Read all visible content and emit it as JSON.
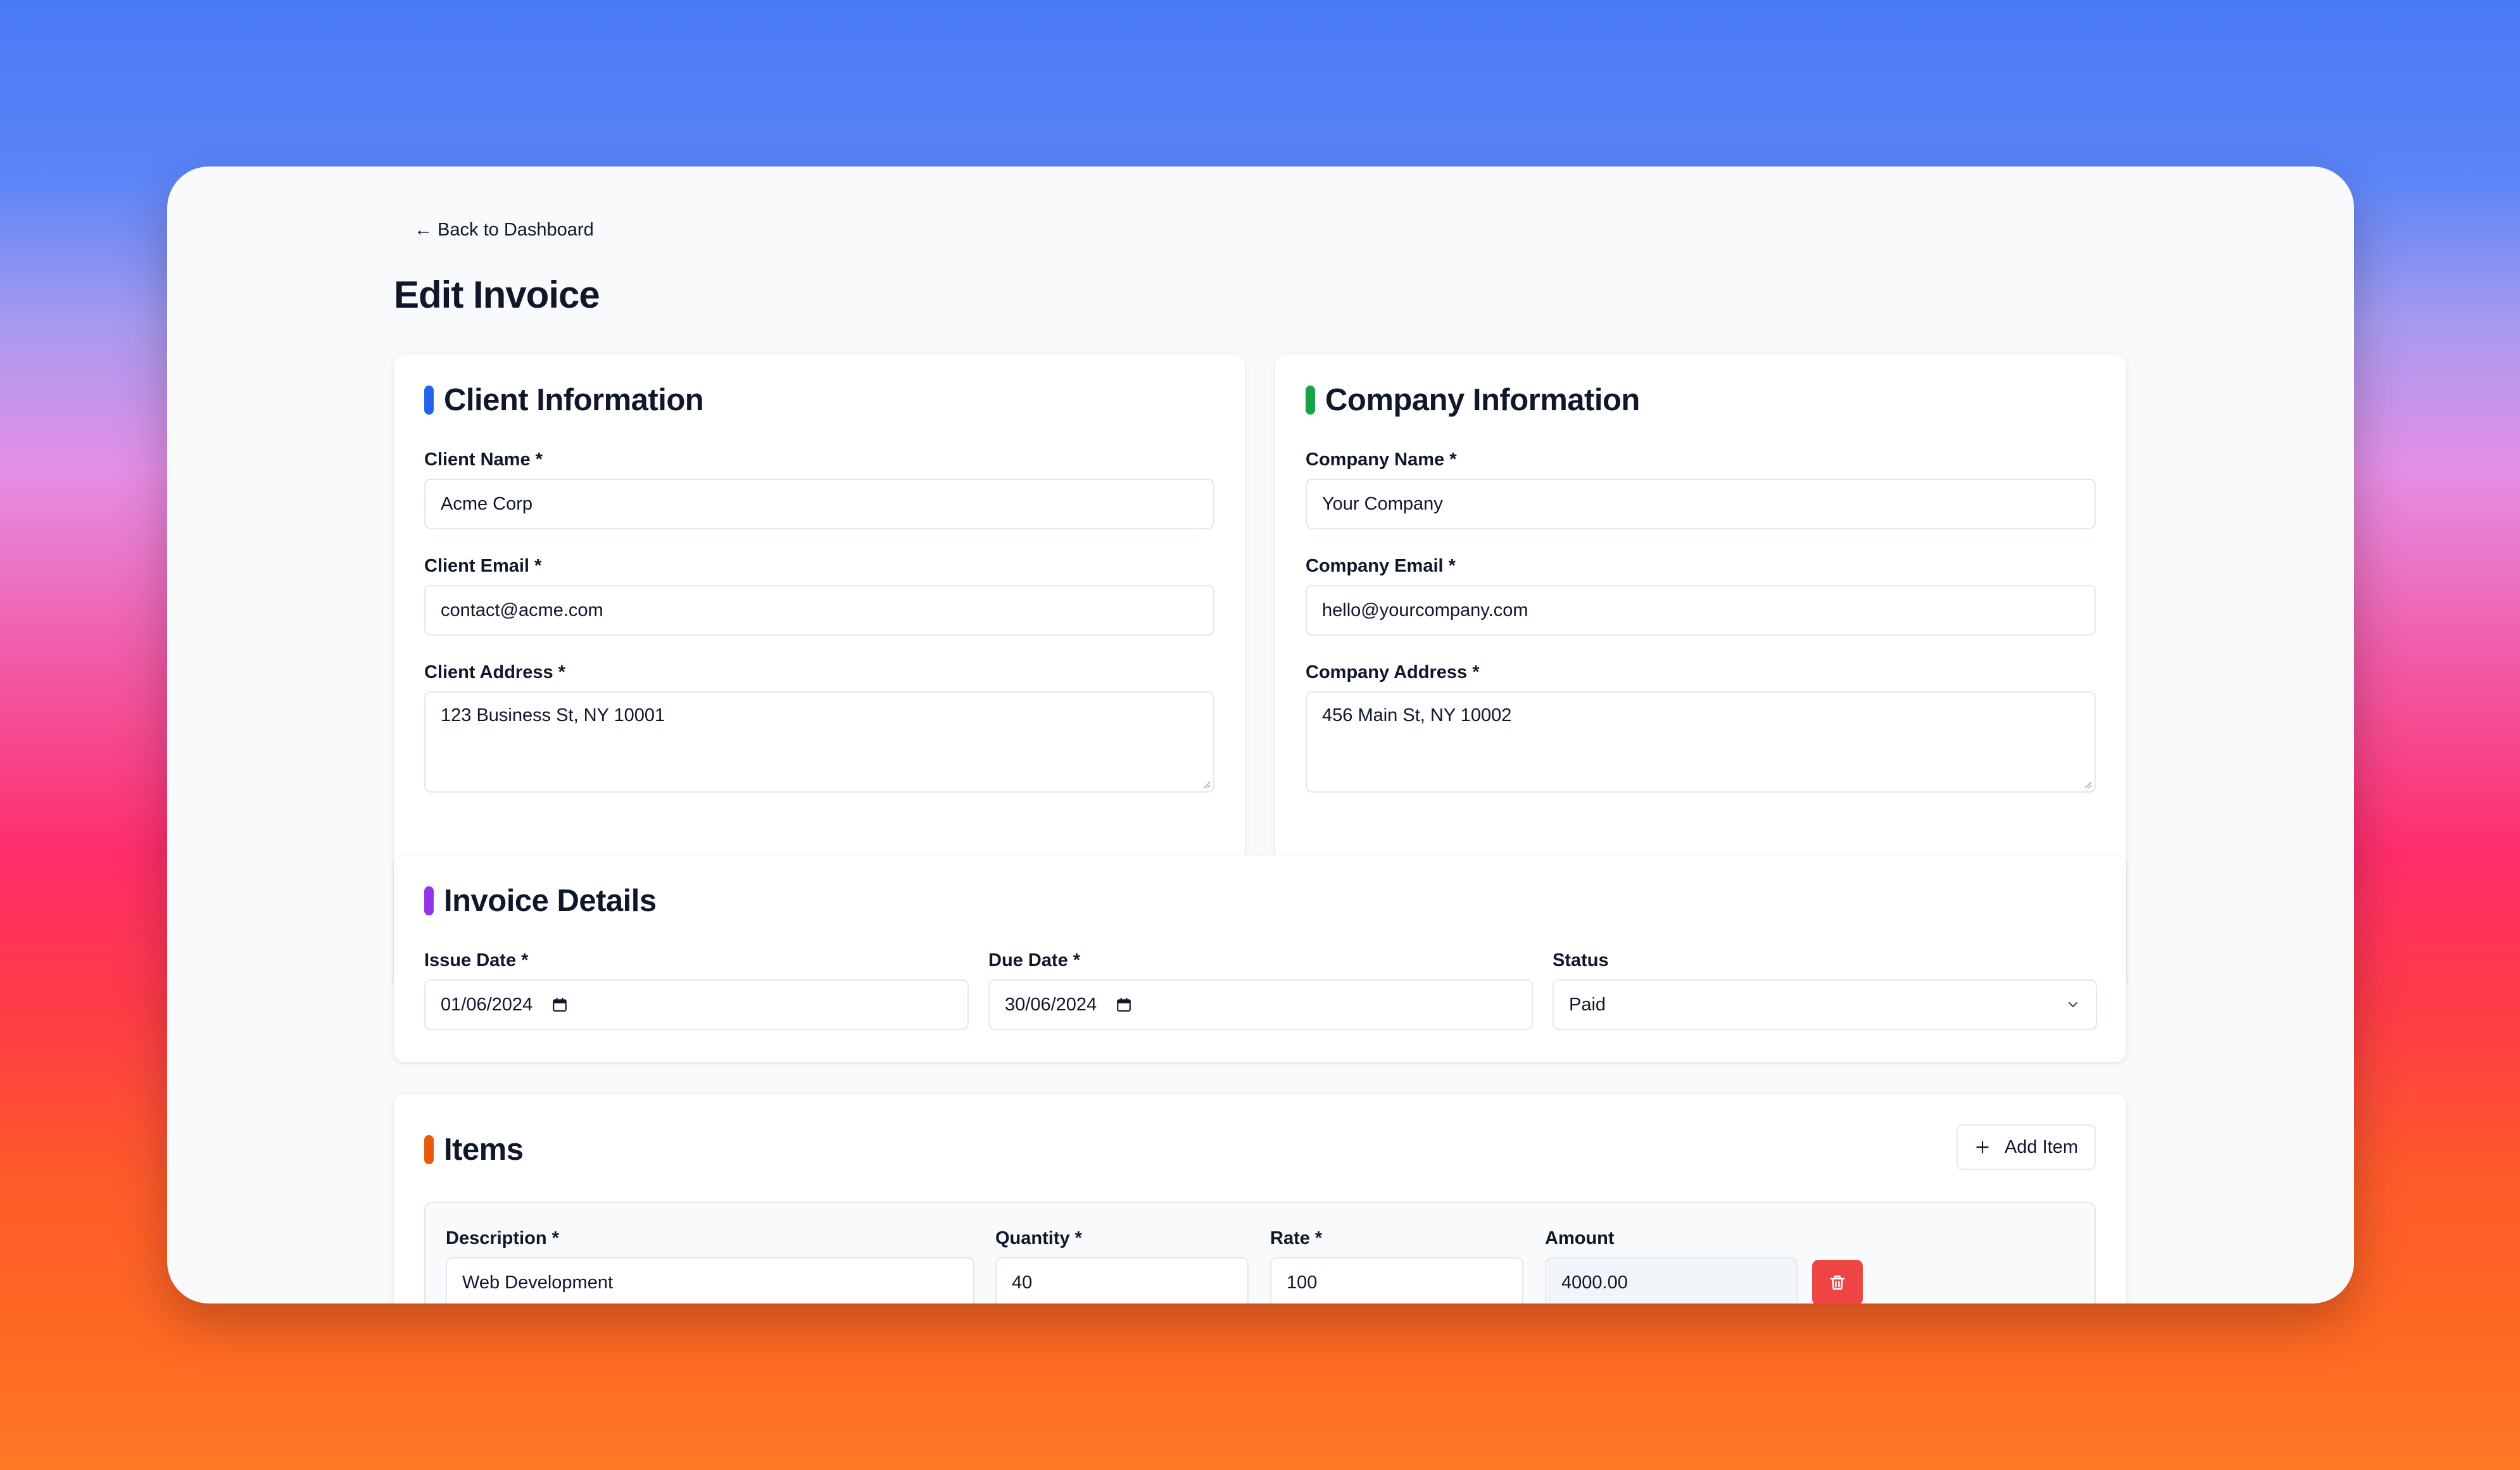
{
  "nav": {
    "back_label": "← Back to Dashboard"
  },
  "page": {
    "title": "Edit Invoice"
  },
  "client": {
    "title": "Client Information",
    "accent": "#2563eb",
    "name_label": "Client Name *",
    "name_value": "Acme Corp",
    "email_label": "Client Email *",
    "email_value": "contact@acme.com",
    "address_label": "Client Address *",
    "address_value": "123 Business St, NY 10001"
  },
  "company": {
    "title": "Company Information",
    "accent": "#16a34a",
    "name_label": "Company Name *",
    "name_value": "Your Company",
    "email_label": "Company Email *",
    "email_value": "hello@yourcompany.com",
    "address_label": "Company Address *",
    "address_value": "456 Main St, NY 10002"
  },
  "details": {
    "title": "Invoice Details",
    "accent": "#9333ea",
    "issue_label": "Issue Date *",
    "issue_value": "01/06/2024",
    "due_label": "Due Date *",
    "due_value": "30/06/2024",
    "status_label": "Status",
    "status_value": "Paid"
  },
  "items": {
    "title": "Items",
    "accent": "#ea580c",
    "add_label": "Add Item",
    "columns": {
      "description": "Description *",
      "quantity": "Quantity *",
      "rate": "Rate *",
      "amount": "Amount"
    },
    "rows": [
      {
        "description": "Web Development",
        "quantity": "40",
        "rate": "100",
        "amount": "4000.00"
      }
    ],
    "delete_color": "#ef4444"
  },
  "icons": {
    "calendar": "calendar-icon",
    "chevron": "chevron-down-icon",
    "plus": "plus-icon",
    "trash": "trash-icon"
  }
}
